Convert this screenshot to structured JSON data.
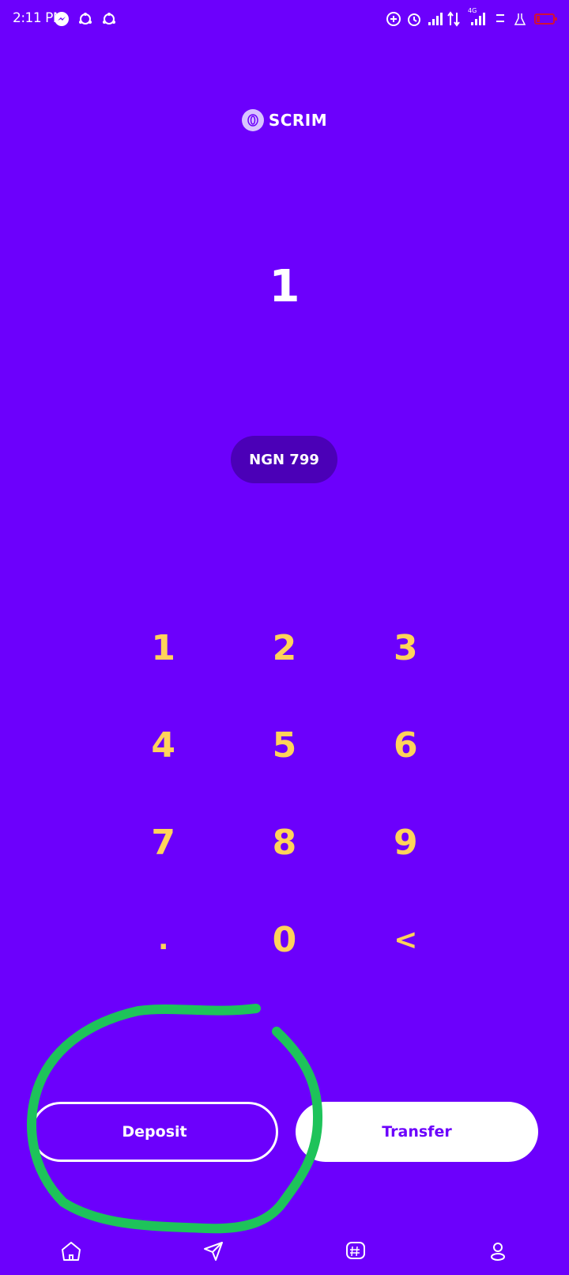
{
  "status_bar": {
    "time": "2:11 PM",
    "network": "4G"
  },
  "brand": {
    "name": "SCRIM"
  },
  "amount": {
    "value": "1"
  },
  "balance": {
    "label": "NGN 799"
  },
  "keypad": {
    "keys": [
      "1",
      "2",
      "3",
      "4",
      "5",
      "6",
      "7",
      "8",
      "9",
      ".",
      "0",
      "<"
    ]
  },
  "actions": {
    "deposit_label": "Deposit",
    "transfer_label": "Transfer"
  },
  "bottom_nav": {
    "items": [
      "home-icon",
      "send-icon",
      "hashtag-icon",
      "profile-icon"
    ]
  },
  "colors": {
    "background": "#6c00fc",
    "pill": "#4b00b7",
    "keypad_digit": "#ffd35a",
    "annotation": "#1ec35a"
  }
}
